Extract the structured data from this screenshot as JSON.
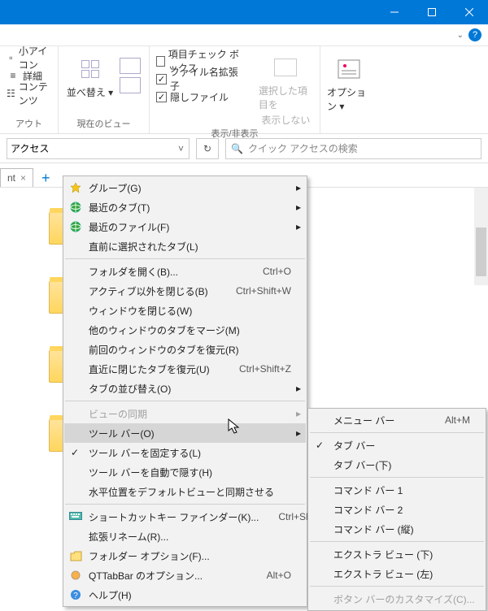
{
  "ribbon": {
    "group1": {
      "items": [
        "小アイコン",
        "詳細",
        "コンテンツ"
      ],
      "label": "アウト"
    },
    "sort": {
      "label": "並べ替え",
      "group_label": "現在のビュー"
    },
    "checkboxes": {
      "chk1": "項目チェック ボックス",
      "chk2": "ファイル名拡張子",
      "chk3": "隠しファイル",
      "group_label": "表示/非表示"
    },
    "hide": {
      "line1": "選択した項目を",
      "line2": "表示しない"
    },
    "options": "オプション"
  },
  "address": {
    "text": "アクセス",
    "search_placeholder": "クイック アクセスの検索"
  },
  "tab": {
    "label": "nt"
  },
  "menu1": [
    {
      "type": "item",
      "icon": "star",
      "label": "グループ(G)",
      "arrow": true
    },
    {
      "type": "item",
      "icon": "globe",
      "label": "最近のタブ(T)",
      "arrow": true
    },
    {
      "type": "item",
      "icon": "globe",
      "label": "最近のファイル(F)",
      "arrow": true
    },
    {
      "type": "item",
      "label": "直前に選択されたタブ(L)"
    },
    {
      "type": "sep"
    },
    {
      "type": "item",
      "label": "フォルダを開く(B)...",
      "shortcut": "Ctrl+O"
    },
    {
      "type": "item",
      "label": "アクティブ以外を閉じる(B)",
      "shortcut": "Ctrl+Shift+W"
    },
    {
      "type": "item",
      "label": "ウィンドウを閉じる(W)"
    },
    {
      "type": "item",
      "label": "他のウィンドウのタブをマージ(M)"
    },
    {
      "type": "item",
      "label": "前回のウィンドウのタブを復元(R)"
    },
    {
      "type": "item",
      "label": "直近に閉じたタブを復元(U)",
      "shortcut": "Ctrl+Shift+Z"
    },
    {
      "type": "item",
      "label": "タブの並び替え(O)",
      "arrow": true
    },
    {
      "type": "sep"
    },
    {
      "type": "item",
      "label": "ビューの同期",
      "arrow": true,
      "disabled": true
    },
    {
      "type": "item",
      "label": "ツール バー(O)",
      "arrow": true,
      "highlight": true
    },
    {
      "type": "item",
      "label": "ツール バーを固定する(L)",
      "check": true
    },
    {
      "type": "item",
      "label": "ツール バーを自動で隠す(H)"
    },
    {
      "type": "item",
      "label": "水平位置をデフォルトビューと同期させる"
    },
    {
      "type": "sep"
    },
    {
      "type": "item",
      "icon": "keyboard",
      "label": "ショートカットキー ファインダー(K)...",
      "shortcut": "Ctrl+Shift+P"
    },
    {
      "type": "item",
      "label": "拡張リネーム(R)..."
    },
    {
      "type": "item",
      "icon": "folder-opt",
      "label": "フォルダー オプション(F)..."
    },
    {
      "type": "item",
      "icon": "gear",
      "label": "QTTabBar のオプション...",
      "shortcut": "Alt+O"
    },
    {
      "type": "item",
      "icon": "help",
      "label": "ヘルプ(H)"
    }
  ],
  "menu2": [
    {
      "type": "item",
      "label": "メニュー バー",
      "shortcut": "Alt+M"
    },
    {
      "type": "sep"
    },
    {
      "type": "item",
      "label": "タブ バー",
      "check": true
    },
    {
      "type": "item",
      "label": "タブ バー(下)"
    },
    {
      "type": "sep"
    },
    {
      "type": "item",
      "label": "コマンド バー 1"
    },
    {
      "type": "item",
      "label": "コマンド バー 2"
    },
    {
      "type": "item",
      "label": "コマンド バー (縦)"
    },
    {
      "type": "sep"
    },
    {
      "type": "item",
      "label": "エクストラ ビュー (下)"
    },
    {
      "type": "item",
      "label": "エクストラ ビュー (左)"
    },
    {
      "type": "sep"
    },
    {
      "type": "item",
      "label": "ボタン バーのカスタマイズ(C)...",
      "disabled": true
    }
  ]
}
